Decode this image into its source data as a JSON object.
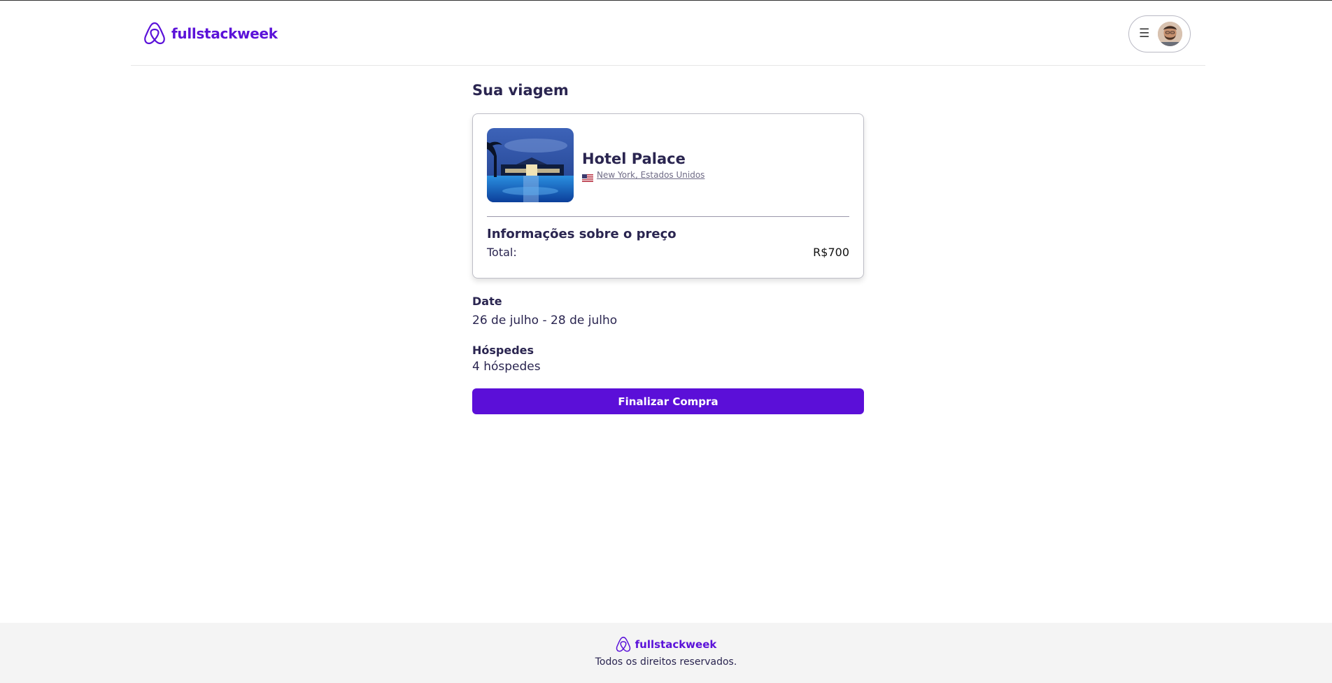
{
  "header": {
    "brand": "fullstackweek",
    "menu_icon": "menu-icon",
    "avatar_alt": "user-avatar"
  },
  "main": {
    "title": "Sua viagem",
    "hotel": {
      "name": "Hotel Palace",
      "location": "New York, Estados Unidos",
      "flag": "us-flag-icon"
    },
    "price": {
      "title": "Informações sobre o preço",
      "total_label": "Total:",
      "total_value": "R$700"
    },
    "date": {
      "label": "Date",
      "value": "26 de julho - 28 de julho"
    },
    "guests": {
      "label": "Hóspedes",
      "value": "4 hóspedes"
    },
    "buy_button": "Finalizar Compra"
  },
  "footer": {
    "brand": "fullstackweek",
    "copyright": "Todos os direitos reservados."
  },
  "colors": {
    "brand": "#5b12d9",
    "button": "#5b0fd8",
    "text": "#2a2550"
  }
}
